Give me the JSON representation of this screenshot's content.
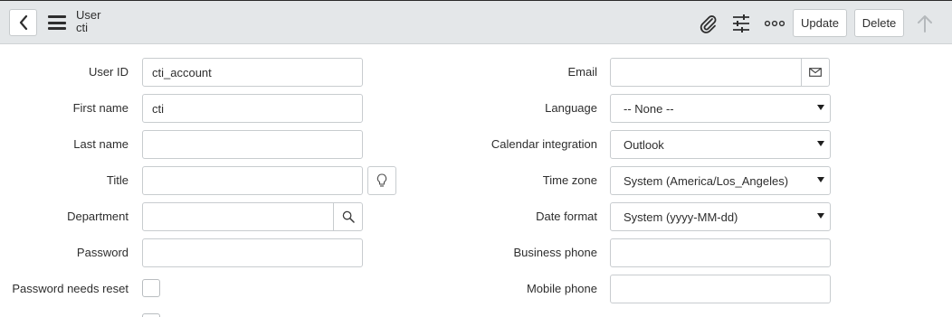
{
  "header": {
    "title": "User",
    "subtitle": "cti",
    "update_label": "Update",
    "delete_label": "Delete",
    "back_icon": "chevron-left-icon",
    "menu_icon": "hamburger-icon",
    "attachment_icon": "paperclip-icon",
    "settings_icon": "sliders-icon",
    "more_icon": "more-options-icon",
    "prev_icon": "arrow-up-icon",
    "next_icon": "arrow-down-icon"
  },
  "left_fields": {
    "user_id": {
      "label": "User ID",
      "value": "cti_account"
    },
    "first_name": {
      "label": "First name",
      "value": "cti"
    },
    "last_name": {
      "label": "Last name",
      "value": ""
    },
    "title": {
      "label": "Title",
      "value": ""
    },
    "department": {
      "label": "Department",
      "value": ""
    },
    "password": {
      "label": "Password",
      "value": ""
    },
    "password_needs_reset": {
      "label": "Password needs reset",
      "checked": false
    }
  },
  "right_fields": {
    "email": {
      "label": "Email",
      "value": ""
    },
    "language": {
      "label": "Language",
      "value": "-- None --"
    },
    "calendar_integration": {
      "label": "Calendar integration",
      "value": "Outlook"
    },
    "time_zone": {
      "label": "Time zone",
      "value": "System (America/Los_Angeles)"
    },
    "date_format": {
      "label": "Date format",
      "value": "System (yyyy-MM-dd)"
    },
    "business_phone": {
      "label": "Business phone",
      "value": ""
    },
    "mobile_phone": {
      "label": "Mobile phone",
      "value": ""
    }
  },
  "colors": {
    "header_bg": "#e4e7e9",
    "border": "#c8cccf",
    "text": "#2e2e2e"
  }
}
